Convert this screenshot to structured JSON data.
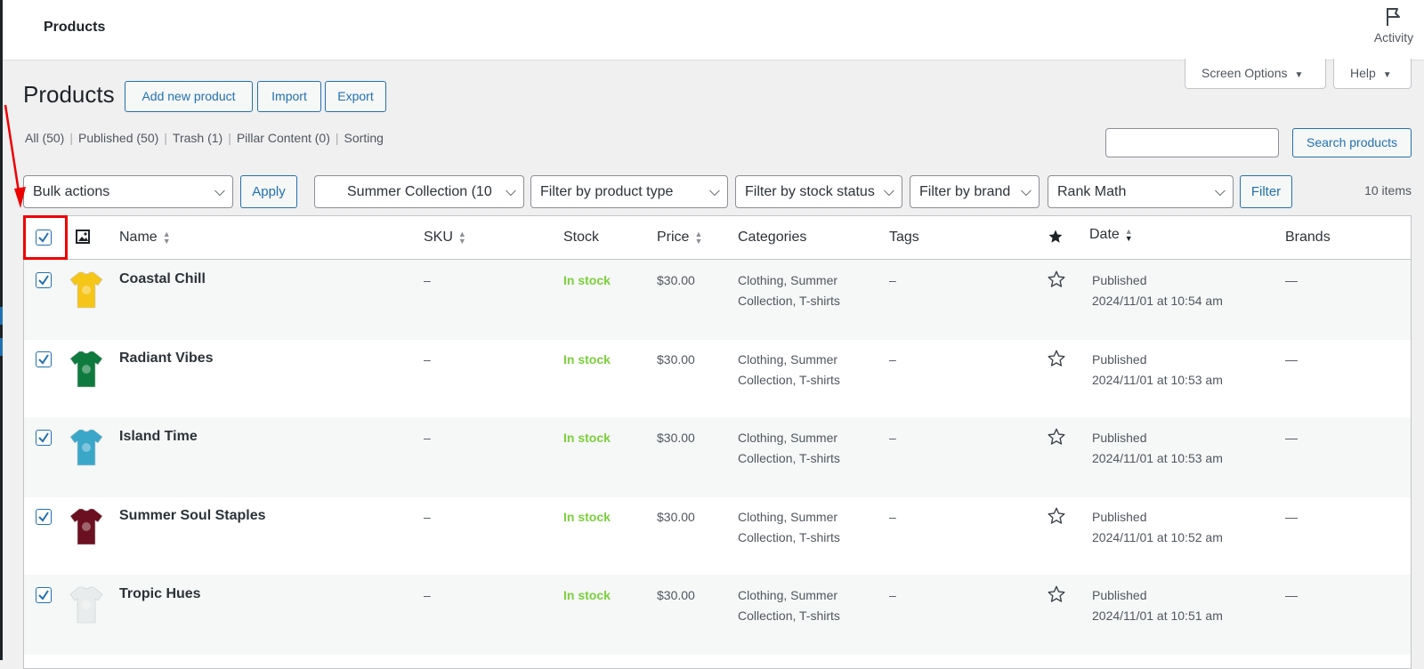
{
  "topbar": {
    "title": "Products",
    "activity_label": "Activity"
  },
  "screen_meta": {
    "screen_options": "Screen Options",
    "help": "Help"
  },
  "header": {
    "title": "Products",
    "add_new": "Add new product",
    "import": "Import",
    "export": "Export"
  },
  "views": [
    {
      "label": "All (50)"
    },
    {
      "label": "Published (50)"
    },
    {
      "label": "Trash (1)"
    },
    {
      "label": "Pillar Content (0)"
    },
    {
      "label": "Sorting"
    }
  ],
  "search": {
    "value": "",
    "button": "Search products"
  },
  "tablenav": {
    "bulk_actions": "Bulk actions",
    "apply": "Apply",
    "category_filter": "Summer Collection  (10",
    "product_type": "Filter by product type",
    "stock_status": "Filter by stock status",
    "brand": "Filter by brand",
    "seo": "Rank Math",
    "filter": "Filter",
    "items_count": "10 items"
  },
  "columns": {
    "name": "Name",
    "sku": "SKU",
    "stock": "Stock",
    "price": "Price",
    "categories": "Categories",
    "tags": "Tags",
    "date": "Date",
    "brands": "Brands"
  },
  "rows": [
    {
      "name": "Coastal Chill",
      "sku": "–",
      "stock": "In stock",
      "price": "$30.00",
      "cat1": "Clothing, Summer",
      "cat2": "Collection, T-shirts",
      "tags": "–",
      "status": "Published",
      "date": "2024/11/01 at 10:54 am",
      "brands": "—",
      "shirt_color": "#f5c518"
    },
    {
      "name": "Radiant Vibes",
      "sku": "–",
      "stock": "In stock",
      "price": "$30.00",
      "cat1": "Clothing, Summer",
      "cat2": "Collection, T-shirts",
      "tags": "–",
      "status": "Published",
      "date": "2024/11/01 at 10:53 am",
      "brands": "—",
      "shirt_color": "#0f7a3d"
    },
    {
      "name": "Island Time",
      "sku": "–",
      "stock": "In stock",
      "price": "$30.00",
      "cat1": "Clothing, Summer",
      "cat2": "Collection, T-shirts",
      "tags": "–",
      "status": "Published",
      "date": "2024/11/01 at 10:53 am",
      "brands": "—",
      "shirt_color": "#3aa7c9"
    },
    {
      "name": "Summer Soul Staples",
      "sku": "–",
      "stock": "In stock",
      "price": "$30.00",
      "cat1": "Clothing, Summer",
      "cat2": "Collection, T-shirts",
      "tags": "–",
      "status": "Published",
      "date": "2024/11/01 at 10:52 am",
      "brands": "—",
      "shirt_color": "#6b1020"
    },
    {
      "name": "Tropic Hues",
      "sku": "–",
      "stock": "In stock",
      "price": "$30.00",
      "cat1": "Clothing, Summer",
      "cat2": "Collection, T-shirts",
      "tags": "–",
      "status": "Published",
      "date": "2024/11/01 at 10:51 am",
      "brands": "—",
      "shirt_color": "#e9ecec"
    }
  ],
  "colors": {
    "accent": "#2271b1",
    "instock": "#7ad03a",
    "highlight": "#e00000"
  }
}
